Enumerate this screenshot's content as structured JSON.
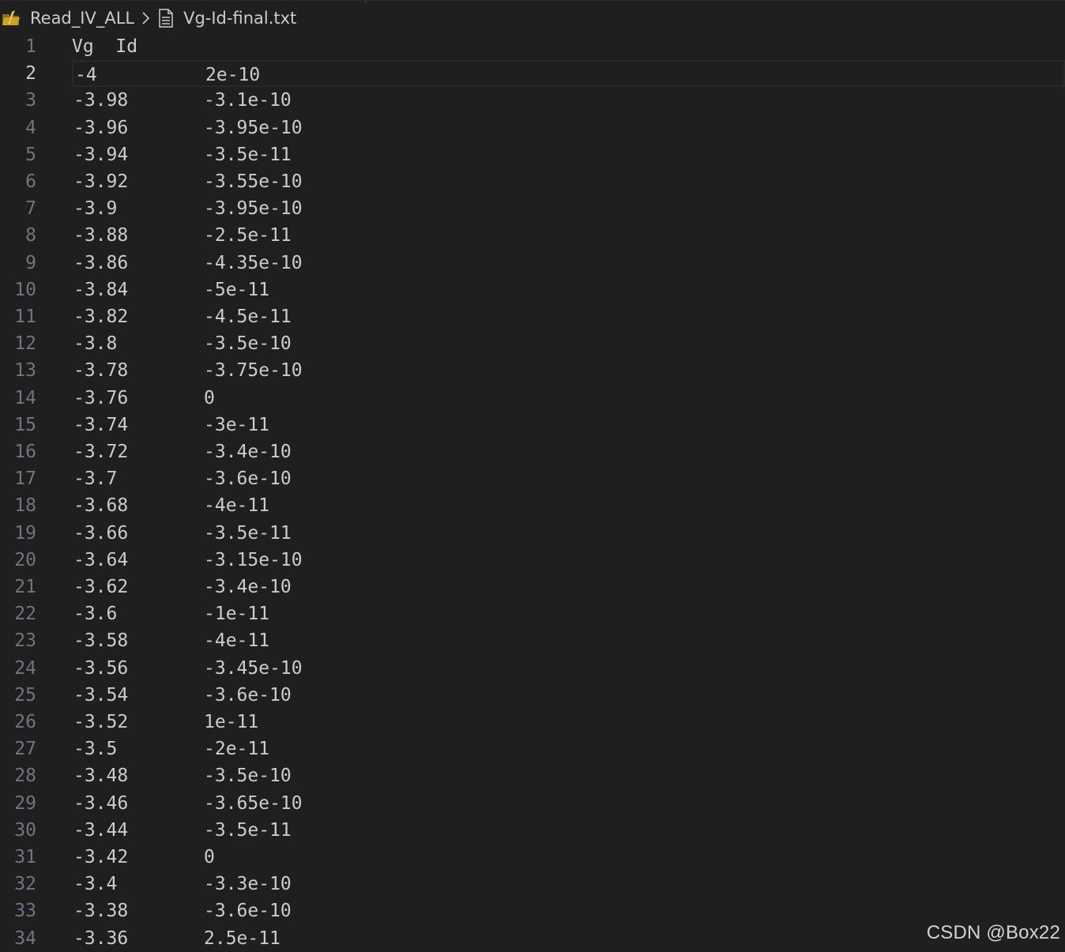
{
  "breadcrumb": {
    "folder": "Read_IV_ALL",
    "file": "Vg-Id-final.txt",
    "folder_icon": "folder-icon",
    "separator_icon": "chevron-right-icon",
    "file_icon": "text-file-icon"
  },
  "editor": {
    "current_line": 2,
    "header": {
      "number": "1",
      "text": "Vg  Id"
    },
    "rows": [
      {
        "number": "2",
        "vg": "-4",
        "id": "2e-10"
      },
      {
        "number": "3",
        "vg": "-3.98",
        "id": "-3.1e-10"
      },
      {
        "number": "4",
        "vg": "-3.96",
        "id": "-3.95e-10"
      },
      {
        "number": "5",
        "vg": "-3.94",
        "id": "-3.5e-11"
      },
      {
        "number": "6",
        "vg": "-3.92",
        "id": "-3.55e-10"
      },
      {
        "number": "7",
        "vg": "-3.9",
        "id": "-3.95e-10"
      },
      {
        "number": "8",
        "vg": "-3.88",
        "id": "-2.5e-11"
      },
      {
        "number": "9",
        "vg": "-3.86",
        "id": "-4.35e-10"
      },
      {
        "number": "10",
        "vg": "-3.84",
        "id": "-5e-11"
      },
      {
        "number": "11",
        "vg": "-3.82",
        "id": "-4.5e-11"
      },
      {
        "number": "12",
        "vg": "-3.8",
        "id": "-3.5e-10"
      },
      {
        "number": "13",
        "vg": "-3.78",
        "id": "-3.75e-10"
      },
      {
        "number": "14",
        "vg": "-3.76",
        "id": "0"
      },
      {
        "number": "15",
        "vg": "-3.74",
        "id": "-3e-11"
      },
      {
        "number": "16",
        "vg": "-3.72",
        "id": "-3.4e-10"
      },
      {
        "number": "17",
        "vg": "-3.7",
        "id": "-3.6e-10"
      },
      {
        "number": "18",
        "vg": "-3.68",
        "id": "-4e-11"
      },
      {
        "number": "19",
        "vg": "-3.66",
        "id": "-3.5e-11"
      },
      {
        "number": "20",
        "vg": "-3.64",
        "id": "-3.15e-10"
      },
      {
        "number": "21",
        "vg": "-3.62",
        "id": "-3.4e-10"
      },
      {
        "number": "22",
        "vg": "-3.6",
        "id": "-1e-11"
      },
      {
        "number": "23",
        "vg": "-3.58",
        "id": "-4e-11"
      },
      {
        "number": "24",
        "vg": "-3.56",
        "id": "-3.45e-10"
      },
      {
        "number": "25",
        "vg": "-3.54",
        "id": "-3.6e-10"
      },
      {
        "number": "26",
        "vg": "-3.52",
        "id": "1e-11"
      },
      {
        "number": "27",
        "vg": "-3.5",
        "id": "-2e-11"
      },
      {
        "number": "28",
        "vg": "-3.48",
        "id": "-3.5e-10"
      },
      {
        "number": "29",
        "vg": "-3.46",
        "id": "-3.65e-10"
      },
      {
        "number": "30",
        "vg": "-3.44",
        "id": "-3.5e-11"
      },
      {
        "number": "31",
        "vg": "-3.42",
        "id": "0"
      },
      {
        "number": "32",
        "vg": "-3.4",
        "id": "-3.3e-10"
      },
      {
        "number": "33",
        "vg": "-3.38",
        "id": "-3.6e-10"
      },
      {
        "number": "34",
        "vg": "-3.36",
        "id": "2.5e-11"
      }
    ]
  },
  "colors": {
    "background": "#1f1f1f",
    "text": "#cccccc",
    "line_number": "#6e7681",
    "current_line_border": "#282828",
    "folder_icon": "#c9a227"
  },
  "watermark": "CSDN @Box22"
}
